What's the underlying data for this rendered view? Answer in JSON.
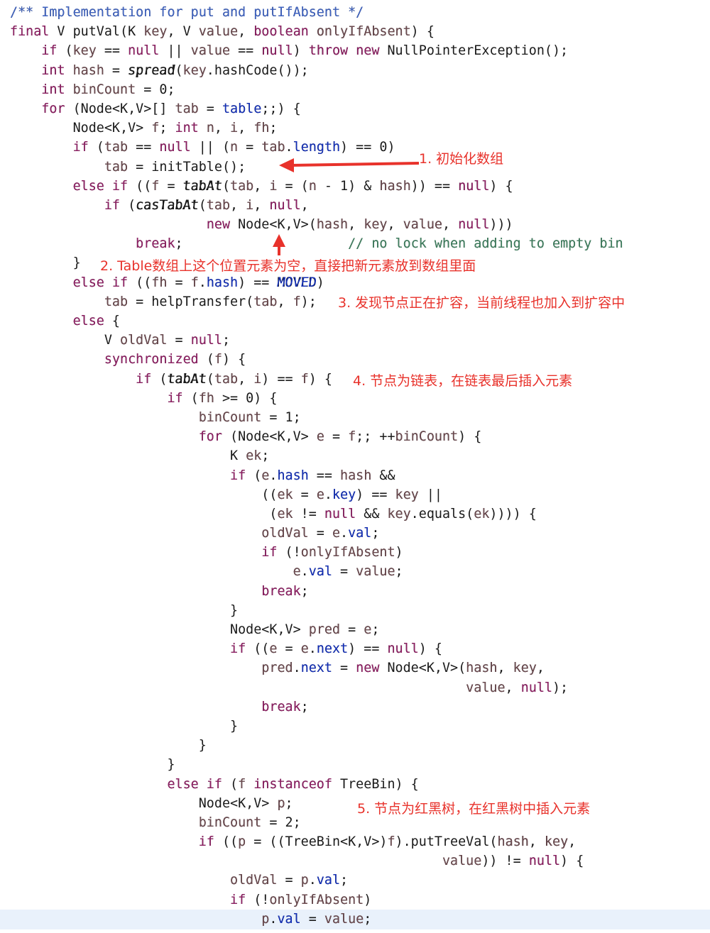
{
  "code": {
    "lines": [
      "/** Implementation for put and putIfAbsent */",
      "final V putVal(K key, V value, boolean onlyIfAbsent) {",
      "    if (key == null || value == null) throw new NullPointerException();",
      "    int hash = spread(key.hashCode());",
      "    int binCount = 0;",
      "    for (Node<K,V>[] tab = table;;) {",
      "        Node<K,V> f; int n, i, fh;",
      "        if (tab == null || (n = tab.length) == 0)",
      "            tab = initTable();",
      "        else if ((f = tabAt(tab, i = (n - 1) & hash)) == null) {",
      "            if (casTabAt(tab, i, null,",
      "                         new Node<K,V>(hash, key, value, null)))",
      "                break;                     // no lock when adding to empty bin",
      "        }",
      "        else if ((fh = f.hash) == MOVED)",
      "            tab = helpTransfer(tab, f);",
      "        else {",
      "            V oldVal = null;",
      "            synchronized (f) {",
      "                if (tabAt(tab, i) == f) {",
      "                    if (fh >= 0) {",
      "                        binCount = 1;",
      "                        for (Node<K,V> e = f;; ++binCount) {",
      "                            K ek;",
      "                            if (e.hash == hash &&",
      "                                ((ek = e.key) == key ||",
      "                                 (ek != null && key.equals(ek)))) {",
      "                                oldVal = e.val;",
      "                                if (!onlyIfAbsent)",
      "                                    e.val = value;",
      "                                break;",
      "                            }",
      "                            Node<K,V> pred = e;",
      "                            if ((e = e.next) == null) {",
      "                                pred.next = new Node<K,V>(hash, key,",
      "                                                          value, null);",
      "                                break;",
      "                            }",
      "                        }",
      "                    }",
      "                    else if (f instanceof TreeBin) {",
      "                        Node<K,V> p;",
      "                        binCount = 2;",
      "                        if ((p = ((TreeBin<K,V>)f).putTreeVal(hash, key,",
      "                                                       value)) != null) {",
      "                            oldVal = p.val;",
      "                            if (!onlyIfAbsent)",
      "                                p.val = value;"
    ],
    "highlighted_line": 47
  },
  "annotations": [
    "1. 初始化数组",
    "2. Table数组上这个位置元素为空，直接把新元素放到数组里面",
    "3. 发现节点正在扩容，当前线程也加入到扩容中",
    "4. 节点为链表，在链表最后插入元素",
    "5. 节点为红黑树，在红黑树中插入元素"
  ],
  "colors": {
    "annotation": "#e8322b",
    "keyword": "#8e1f63",
    "variable": "#6b4a4f",
    "field": "#1430b8",
    "javadoc": "#3e62c0",
    "comment": "#3f7f5f",
    "highlight": "#e9f1fb"
  }
}
